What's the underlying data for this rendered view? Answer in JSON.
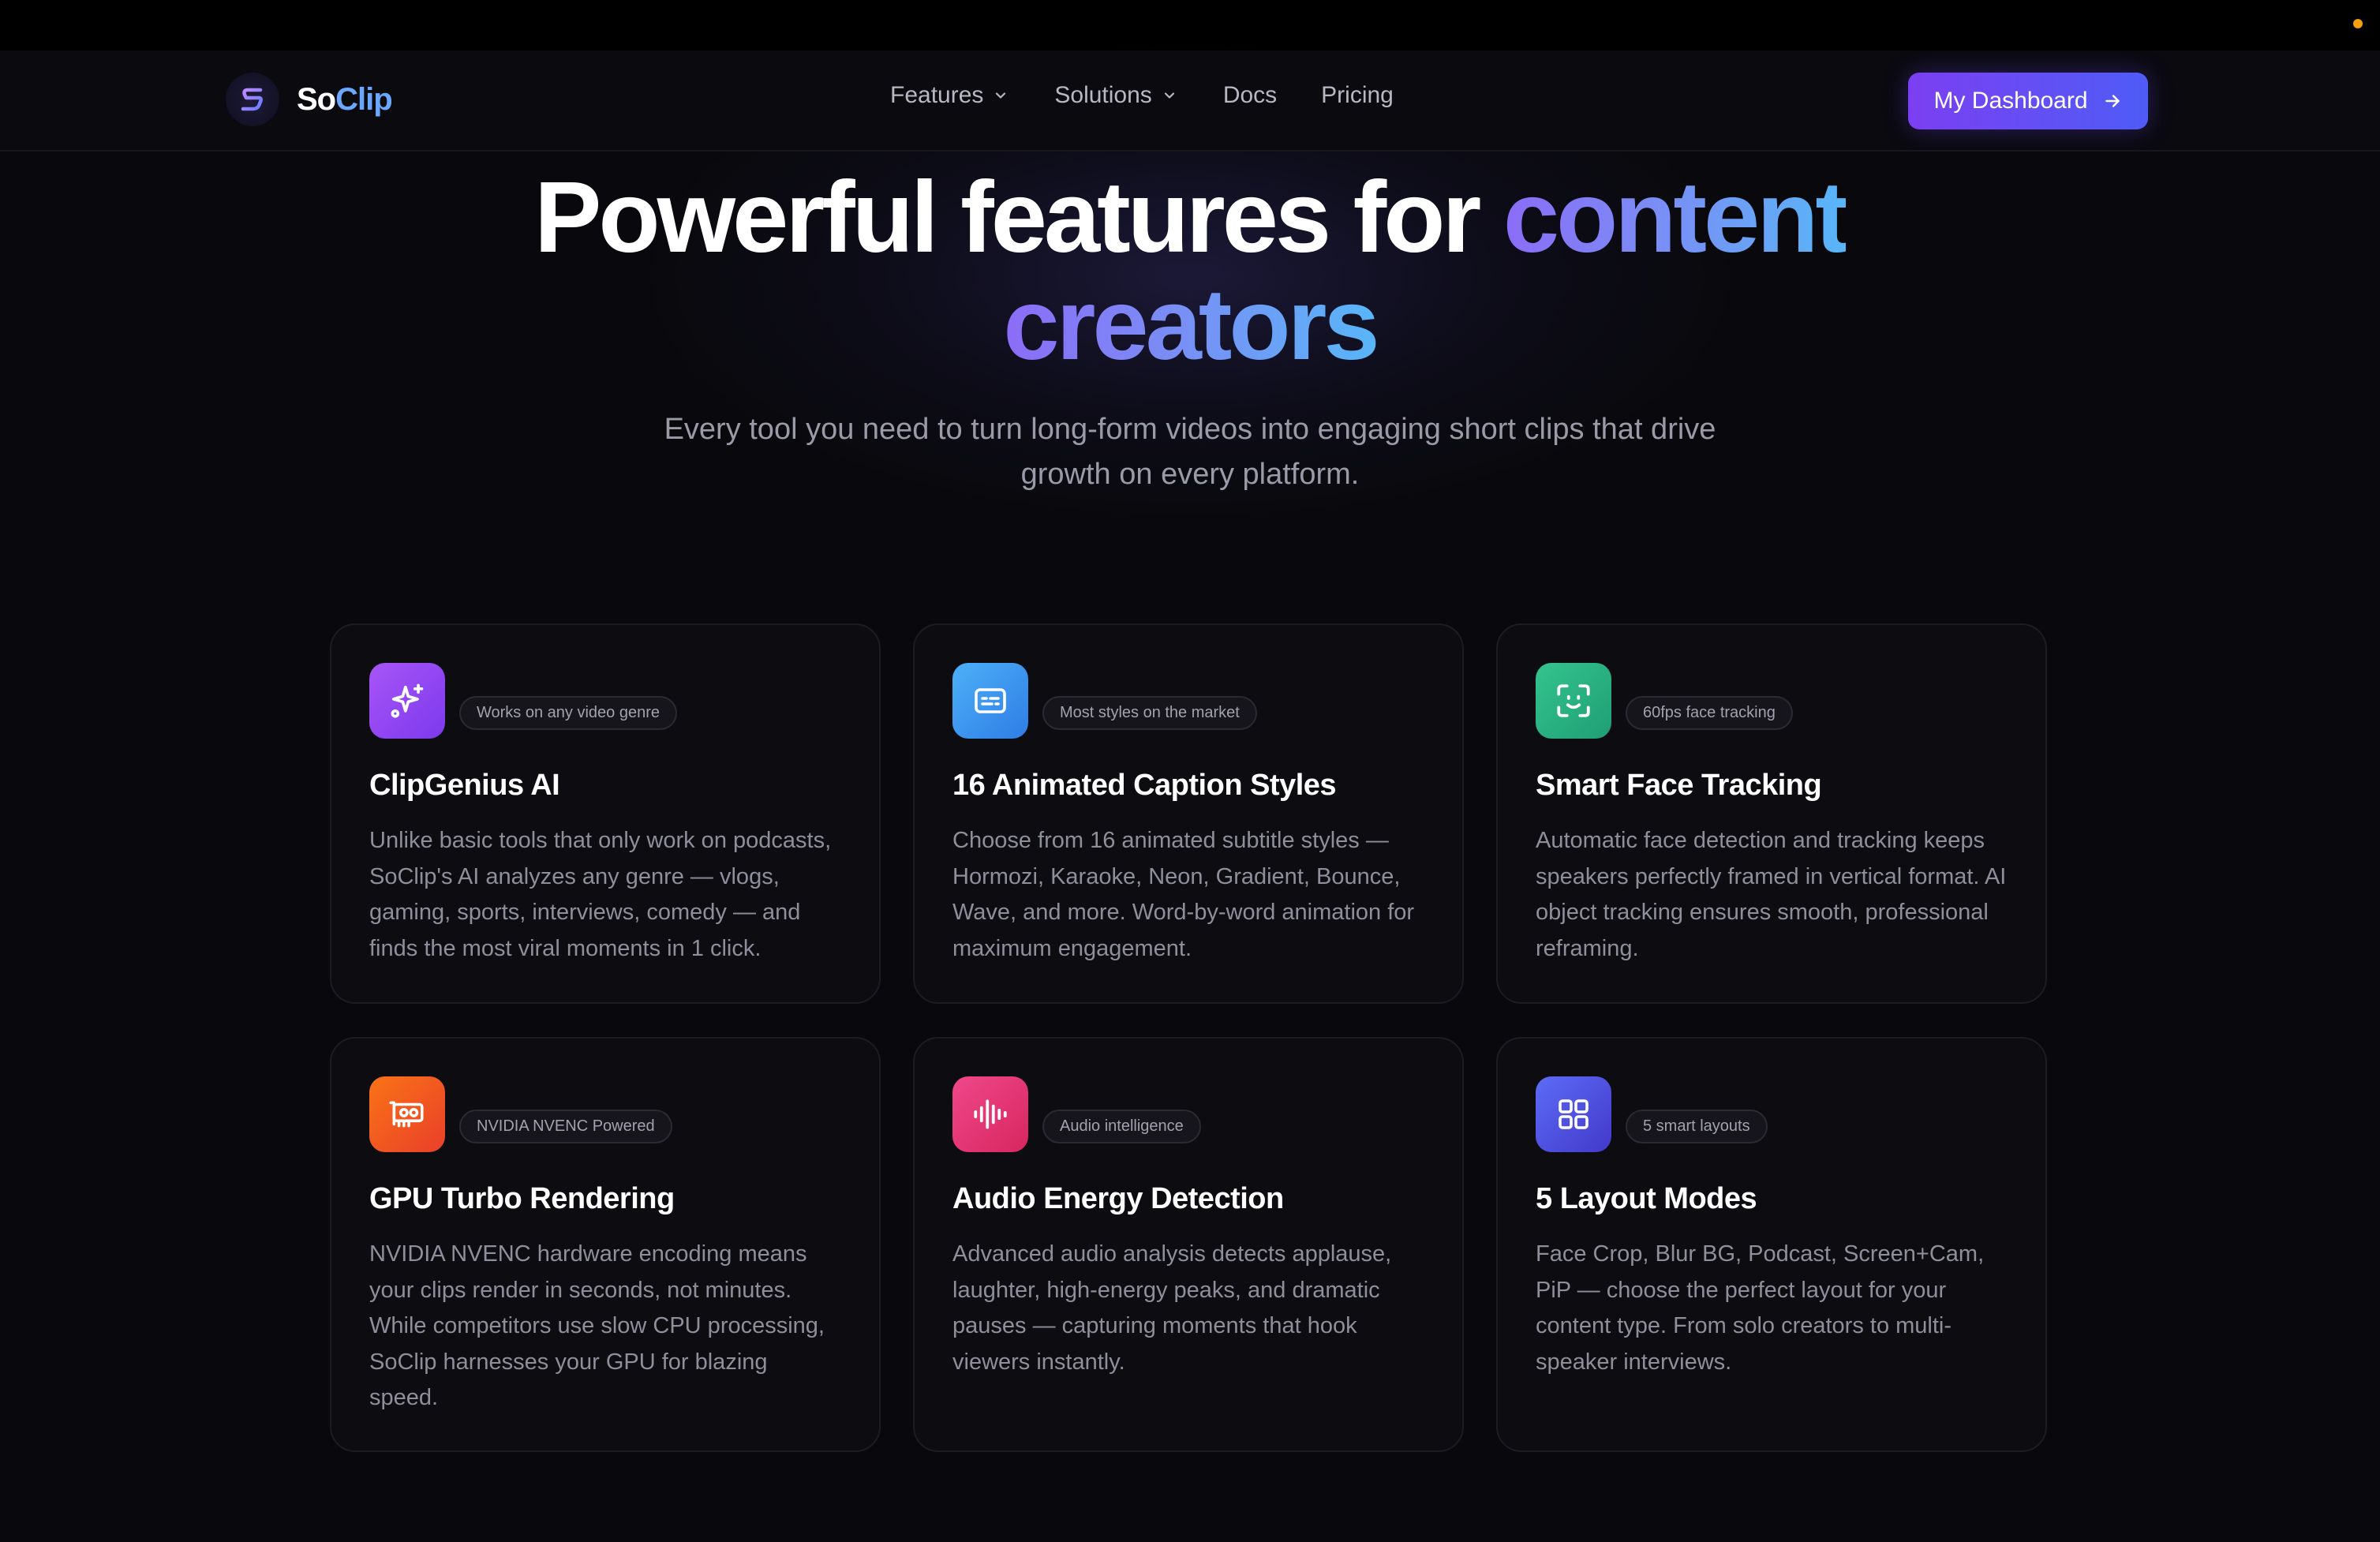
{
  "brand": {
    "name_part1": "So",
    "name_part2": "Clip"
  },
  "nav": {
    "items": [
      {
        "label": "Features",
        "has_dropdown": true
      },
      {
        "label": "Solutions",
        "has_dropdown": true
      },
      {
        "label": "Docs",
        "has_dropdown": false
      },
      {
        "label": "Pricing",
        "has_dropdown": false
      }
    ],
    "cta_label": "My Dashboard"
  },
  "hero": {
    "title_plain": "Powerful features for ",
    "title_highlight_1": "content",
    "title_highlight_2": "creators",
    "subtitle": "Every tool you need to turn long-form videos into engaging short clips that drive growth on every platform."
  },
  "features": [
    {
      "icon": "sparkles-icon",
      "badge": "Works on any video genre",
      "title": "ClipGenius AI",
      "description": "Unlike basic tools that only work on podcasts, SoClip's AI analyzes any genre — vlogs, gaming, sports, interviews, comedy — and finds the most viral moments in 1 click.",
      "color_from": "#a855f7",
      "color_to": "#7c3aed"
    },
    {
      "icon": "captions-icon",
      "badge": "Most styles on the market",
      "title": "16 Animated Caption Styles",
      "description": "Choose from 16 animated subtitle styles — Hormozi, Karaoke, Neon, Gradient, Bounce, Wave, and more. Word-by-word animation for maximum engagement.",
      "color_from": "#4cb0f7",
      "color_to": "#2f7de6"
    },
    {
      "icon": "face-scan-icon",
      "badge": "60fps face tracking",
      "title": "Smart Face Tracking",
      "description": "Automatic face detection and tracking keeps speakers perfectly framed in vertical format. AI object tracking ensures smooth, professional reframing.",
      "color_from": "#34c38f",
      "color_to": "#1f9f74"
    },
    {
      "icon": "gpu-card-icon",
      "badge": "NVIDIA NVENC Powered",
      "title": "GPU Turbo Rendering",
      "description": "NVIDIA NVENC hardware encoding means your clips render in seconds, not minutes. While competitors use slow CPU processing, SoClip harnesses your GPU for blazing speed.",
      "color_from": "#f97316",
      "color_to": "#ea3f2a"
    },
    {
      "icon": "audio-waveform-icon",
      "badge": "Audio intelligence",
      "title": "Audio Energy Detection",
      "description": "Advanced audio analysis detects applause, laughter, high-energy peaks, and dramatic pauses — capturing moments that hook viewers instantly.",
      "color_from": "#f0488a",
      "color_to": "#d8265f"
    },
    {
      "icon": "layout-grid-icon",
      "badge": "5 smart layouts",
      "title": "5 Layout Modes",
      "description": "Face Crop, Blur BG, Podcast, Screen+Cam, PiP — choose the perfect layout for your content type. From solo creators to multi-speaker interviews.",
      "color_from": "#5c6cf6",
      "color_to": "#4338ca"
    }
  ]
}
